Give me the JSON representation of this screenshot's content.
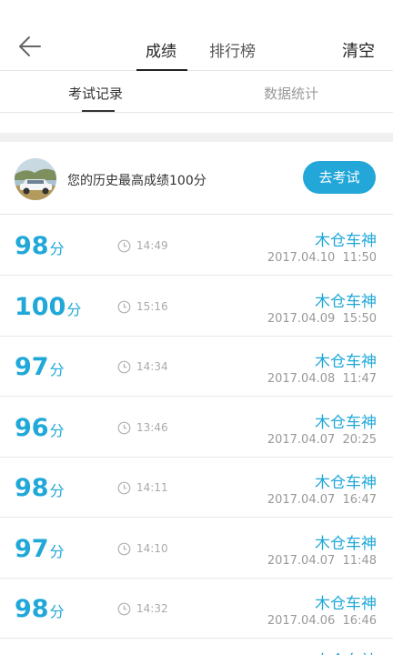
{
  "header": {
    "tabs": [
      {
        "label": "成绩",
        "active": true
      },
      {
        "label": "排行榜",
        "active": false
      }
    ],
    "clear_label": "清空",
    "back_icon": "back-arrow-icon"
  },
  "subtabs": [
    {
      "label": "考试记录",
      "active": true
    },
    {
      "label": "数据统计",
      "active": false
    }
  ],
  "summary": {
    "text": "您的历史最高成绩100分",
    "button_label": "去考试"
  },
  "records": [
    {
      "score": "98",
      "unit": "分",
      "duration": "14:49",
      "name": "木仓车神",
      "date": "2017.04.10",
      "time": "11:50"
    },
    {
      "score": "100",
      "unit": "分",
      "duration": "15:16",
      "name": "木仓车神",
      "date": "2017.04.09",
      "time": "15:50"
    },
    {
      "score": "97",
      "unit": "分",
      "duration": "14:34",
      "name": "木仓车神",
      "date": "2017.04.08",
      "time": "11:47"
    },
    {
      "score": "96",
      "unit": "分",
      "duration": "13:46",
      "name": "木仓车神",
      "date": "2017.04.07",
      "time": "20:25"
    },
    {
      "score": "98",
      "unit": "分",
      "duration": "14:11",
      "name": "木仓车神",
      "date": "2017.04.07",
      "time": "16:47"
    },
    {
      "score": "97",
      "unit": "分",
      "duration": "14:10",
      "name": "木仓车神",
      "date": "2017.04.07",
      "time": "11:48"
    },
    {
      "score": "98",
      "unit": "分",
      "duration": "14:32",
      "name": "木仓车神",
      "date": "2017.04.06",
      "time": "16:46"
    }
  ],
  "partial_record": {
    "name": "木仓车神"
  },
  "colors": {
    "accent": "#20a8d8",
    "button": "#22a7d8"
  }
}
